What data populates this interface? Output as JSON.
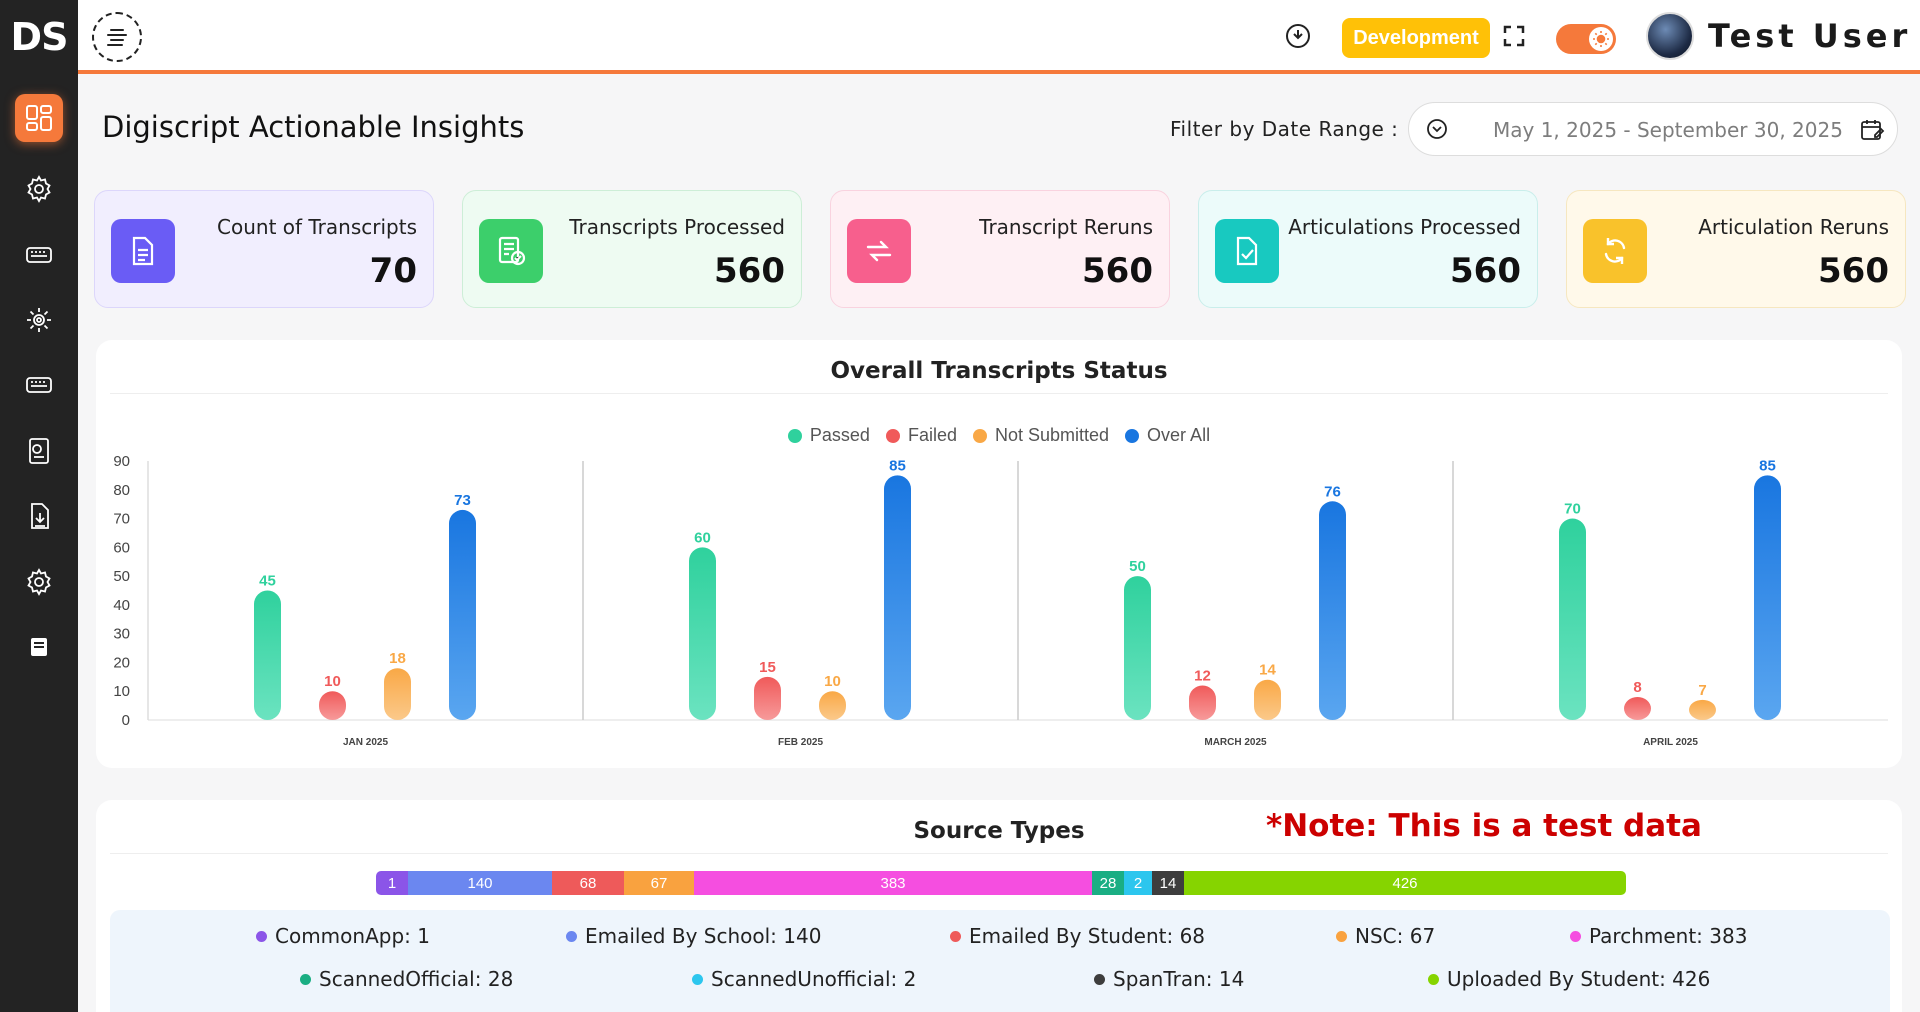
{
  "app": {
    "logo": "DS",
    "env_badge": "Development",
    "user_name": "Test User"
  },
  "sidebar": {
    "items": [
      {
        "name": "dashboard-icon",
        "active": true
      },
      {
        "name": "gear-icon"
      },
      {
        "name": "keyboard-icon"
      },
      {
        "name": "cog-icon"
      },
      {
        "name": "keyboard-icon-2"
      },
      {
        "name": "report-icon"
      },
      {
        "name": "download-icon"
      },
      {
        "name": "settings-icon"
      },
      {
        "name": "book-icon"
      }
    ]
  },
  "page": {
    "title": "Digiscript Actionable Insights",
    "filter_label": "Filter by Date Range :",
    "date_range": "May 1, 2025 - September 30, 2025"
  },
  "stats": [
    {
      "label": "Count of Transcripts",
      "value": "70",
      "icon": "document-icon",
      "accent": "#6a5cf5",
      "bg": "#f1eefe",
      "border": "#dcd6fb"
    },
    {
      "label": "Transcripts Processed",
      "value": "560",
      "icon": "processed-icon",
      "accent": "#3ccf6b",
      "bg": "#eefbf2",
      "border": "#cdeed7"
    },
    {
      "label": "Transcript Reruns",
      "value": "560",
      "icon": "rerun-icon",
      "accent": "#f75f8d",
      "bg": "#fef0f4",
      "border": "#f9d3df"
    },
    {
      "label": "Articulations Processed",
      "value": "560",
      "icon": "articulation-icon",
      "accent": "#18c9c0",
      "bg": "#ecfbfa",
      "border": "#c9eeeb"
    },
    {
      "label": "Articulation Reruns",
      "value": "560",
      "icon": "refresh-icon",
      "accent": "#f9c22b",
      "bg": "#fff9ea",
      "border": "#f6e7c0"
    }
  ],
  "chart_data": {
    "type": "bar",
    "title": "Overall Transcripts Status",
    "categories": [
      "JAN 2025",
      "FEB 2025",
      "MARCH 2025",
      "APRIL 2025"
    ],
    "series": [
      {
        "name": "Passed",
        "color": "#2fd19d",
        "values": [
          45,
          60,
          50,
          70
        ]
      },
      {
        "name": "Failed",
        "color": "#f05a5a",
        "values": [
          10,
          15,
          12,
          8
        ]
      },
      {
        "name": "Not Submitted",
        "color": "#f9a846",
        "values": [
          18,
          10,
          14,
          7
        ]
      },
      {
        "name": "Over All",
        "color": "#1976e0",
        "values": [
          73,
          85,
          76,
          85
        ]
      }
    ],
    "ylim": [
      0,
      90
    ],
    "yticks": [
      "0",
      "10",
      "20",
      "30",
      "40",
      "50",
      "60",
      "70",
      "80",
      "90"
    ],
    "legend": "top",
    "grid": false
  },
  "source_types": {
    "title": "Source Types",
    "note": "*Note: This is a test data",
    "items": [
      {
        "name": "CommonApp",
        "value": 1,
        "label": "CommonApp: 1",
        "color": "#8b55e8"
      },
      {
        "name": "Emailed By School",
        "value": 140,
        "label": "Emailed By School: 140",
        "color": "#6b87f0"
      },
      {
        "name": "Emailed By Student",
        "value": 68,
        "label": "Emailed By Student: 68",
        "color": "#ee5a5a"
      },
      {
        "name": "NSC",
        "value": 67,
        "label": "NSC: 67",
        "color": "#f9a23f"
      },
      {
        "name": "Parchment",
        "value": 383,
        "label": "Parchment: 383",
        "color": "#f54ee0"
      },
      {
        "name": "ScannedOfficial",
        "value": 28,
        "label": "ScannedOfficial: 28",
        "color": "#1aae83"
      },
      {
        "name": "ScannedUnofficial",
        "value": 2,
        "label": "ScannedUnofficial: 2",
        "color": "#2cc6ee"
      },
      {
        "name": "SpanTran",
        "value": 14,
        "label": "SpanTran: 14",
        "color": "#3d3d3d"
      },
      {
        "name": "Uploaded By Student",
        "value": 426,
        "label": "Uploaded By Student: 426",
        "color": "#86d400"
      }
    ]
  }
}
